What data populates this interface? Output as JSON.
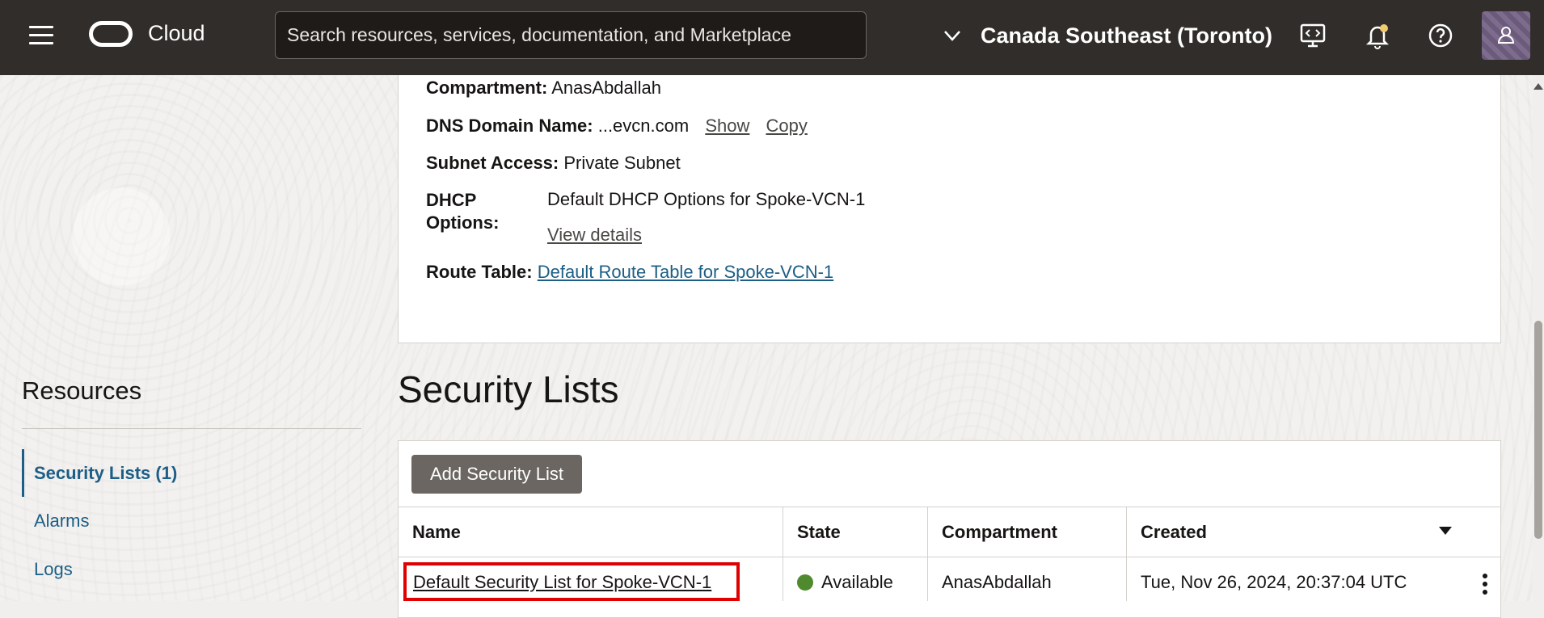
{
  "header": {
    "brand": "Cloud",
    "search_placeholder": "Search resources, services, documentation, and Marketplace",
    "region": "Canada Southeast (Toronto)"
  },
  "details": {
    "compartment_label": "Compartment:",
    "compartment_value": "AnasAbdallah",
    "dns_label": "DNS Domain Name:",
    "dns_value": "...evcn.com",
    "dns_show": "Show",
    "dns_copy": "Copy",
    "subnet_access_label": "Subnet Access:",
    "subnet_access_value": "Private Subnet",
    "dhcp_label_1": "DHCP",
    "dhcp_label_2": "Options:",
    "dhcp_value": "Default DHCP Options for Spoke-VCN-1",
    "dhcp_view": "View details",
    "route_label": "Route Table:",
    "route_value": "Default Route Table for Spoke-VCN-1"
  },
  "resources": {
    "title": "Resources",
    "items": [
      {
        "label": "Security Lists (1)",
        "active": true
      },
      {
        "label": "Alarms",
        "active": false
      },
      {
        "label": "Logs",
        "active": false
      }
    ]
  },
  "security_lists": {
    "title": "Security Lists",
    "add_button": "Add Security List",
    "columns": [
      "Name",
      "State",
      "Compartment",
      "Created"
    ],
    "rows": [
      {
        "name": "Default Security List for Spoke-VCN-1",
        "state": "Available",
        "compartment": "AnasAbdallah",
        "created": "Tue, Nov 26, 2024, 20:37:04 UTC"
      }
    ]
  },
  "colors": {
    "header_bg": "#312d2a",
    "link": "#1c5e86",
    "available": "#508a2e",
    "highlight": "#e00000"
  }
}
